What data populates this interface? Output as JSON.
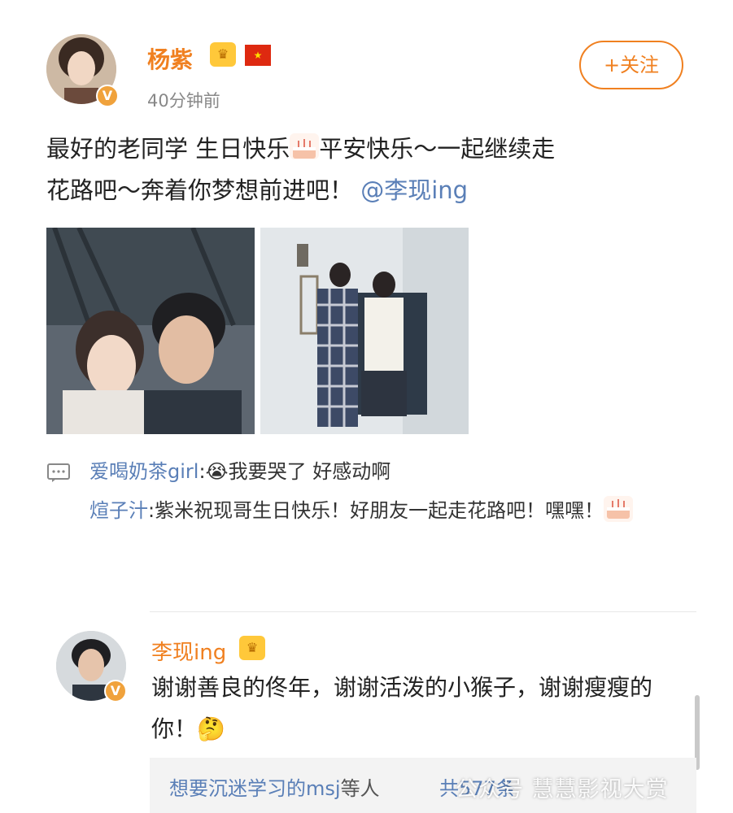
{
  "post": {
    "author_name": "杨紫",
    "time": "40分钟前",
    "follow_label": "+关注",
    "text_line1": "最好的老同学 生日快乐",
    "text_line1b": "平安快乐～一起继续走",
    "text_line2": "花路吧～奔着你梦想前进吧！",
    "mention": "@李现ing",
    "icons": {
      "verified": "verified-badge-icon",
      "crown": "vip-crown-icon",
      "flag": "china-flag-icon",
      "cake": "birthday-cake-emoji",
      "comment": "comment-icon"
    },
    "colors": {
      "accent": "#f08020",
      "link": "#5a7fb7"
    }
  },
  "comments": [
    {
      "user": "爱喝奶茶girl",
      "text": "我要哭了 好感动啊"
    },
    {
      "user": "煊子汁",
      "text": "紫米祝现哥生日快乐！好朋友一起走花路吧！嘿嘿！"
    }
  ],
  "reply": {
    "author_name": "李现ing",
    "text": "谢谢善良的佟年，谢谢活泼的小猴子，谢谢瘦瘦的你！"
  },
  "likes": {
    "text": "想要沉迷学习的msj",
    "suffix": "等人",
    "count": "共577条"
  },
  "watermark": "公众号 慧慧影视大赏"
}
